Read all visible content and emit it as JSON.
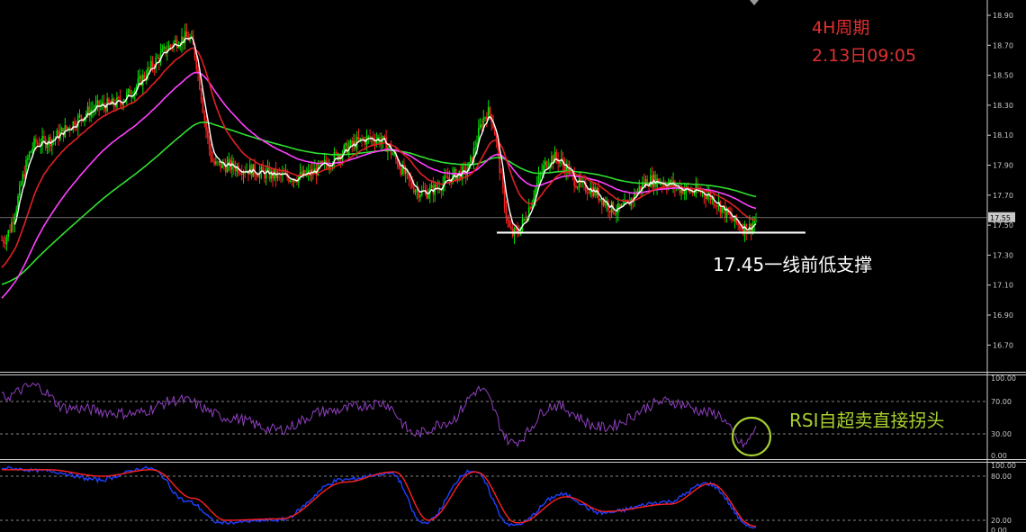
{
  "chart_data": [
    {
      "type": "candlestick",
      "panel": "price",
      "annotations": {
        "timeframe": "4H周期",
        "timestamp": "2.13日09:05",
        "support_label": "17.45一线前低支撑"
      },
      "y_ticks": [
        "18.90",
        "18.70",
        "18.50",
        "18.30",
        "18.10",
        "17.90",
        "17.70",
        "17.50",
        "17.30",
        "17.10",
        "16.90",
        "16.70"
      ],
      "ylim": [
        16.6,
        18.98
      ],
      "current_price": "17.55",
      "support_level": 17.45,
      "colors": {
        "bull": "#00e000",
        "bear": "#ff2020",
        "ma_fast": "#ffffff",
        "ma_mid": "#e02020",
        "ma_slow1": "#ff40ff",
        "ma_slow2": "#30e030",
        "support_line": "#ffffff"
      },
      "key_points": [
        {
          "time": 0,
          "price": 17.4
        },
        {
          "time": 22,
          "price": 18.05
        },
        {
          "time": 65,
          "price": 18.3
        },
        {
          "time": 115,
          "price": 18.75
        },
        {
          "time": 132,
          "price": 17.9
        },
        {
          "time": 180,
          "price": 17.82
        },
        {
          "time": 230,
          "price": 18.08
        },
        {
          "time": 260,
          "price": 17.72
        },
        {
          "time": 285,
          "price": 17.85
        },
        {
          "time": 300,
          "price": 18.25
        },
        {
          "time": 315,
          "price": 17.44
        },
        {
          "time": 340,
          "price": 17.95
        },
        {
          "time": 360,
          "price": 17.75
        },
        {
          "time": 380,
          "price": 17.6
        },
        {
          "time": 400,
          "price": 17.8
        },
        {
          "time": 430,
          "price": 17.72
        },
        {
          "time": 460,
          "price": 17.48
        },
        {
          "time": 465,
          "price": 17.53
        }
      ]
    },
    {
      "type": "line",
      "panel": "rsi",
      "annotation": "RSI自超卖直接拐头",
      "y_ticks": [
        "100.00",
        "70.00",
        "30.00",
        "0.00"
      ],
      "ylim": [
        0,
        100
      ],
      "levels": [
        70,
        30
      ],
      "colors": {
        "line": "#9040c0",
        "circle": "#a8d030"
      },
      "key_points": [
        {
          "time": 0,
          "value": 75
        },
        {
          "time": 20,
          "value": 90
        },
        {
          "time": 40,
          "value": 62
        },
        {
          "time": 80,
          "value": 55
        },
        {
          "time": 110,
          "value": 72
        },
        {
          "time": 140,
          "value": 50
        },
        {
          "time": 170,
          "value": 35
        },
        {
          "time": 200,
          "value": 58
        },
        {
          "time": 235,
          "value": 68
        },
        {
          "time": 255,
          "value": 30
        },
        {
          "time": 275,
          "value": 45
        },
        {
          "time": 295,
          "value": 85
        },
        {
          "time": 315,
          "value": 18
        },
        {
          "time": 340,
          "value": 65
        },
        {
          "time": 370,
          "value": 38
        },
        {
          "time": 410,
          "value": 70
        },
        {
          "time": 440,
          "value": 55
        },
        {
          "time": 458,
          "value": 15
        },
        {
          "time": 465,
          "value": 35
        }
      ]
    },
    {
      "type": "line",
      "panel": "stochastic",
      "y_ticks": [
        "100.00",
        "80.00",
        "20.00",
        "0.00"
      ],
      "ylim": [
        0,
        100
      ],
      "levels": [
        80,
        20
      ],
      "series": [
        {
          "color": "#2040ff",
          "key_points": [
            {
              "time": 0,
              "value": 95
            },
            {
              "time": 25,
              "value": 90
            },
            {
              "time": 60,
              "value": 75
            },
            {
              "time": 90,
              "value": 95
            },
            {
              "time": 115,
              "value": 45
            },
            {
              "time": 135,
              "value": 15
            },
            {
              "time": 170,
              "value": 20
            },
            {
              "time": 210,
              "value": 75
            },
            {
              "time": 240,
              "value": 85
            },
            {
              "time": 260,
              "value": 15
            },
            {
              "time": 290,
              "value": 90
            },
            {
              "time": 315,
              "value": 10
            },
            {
              "time": 345,
              "value": 55
            },
            {
              "time": 370,
              "value": 30
            },
            {
              "time": 410,
              "value": 45
            },
            {
              "time": 435,
              "value": 70
            },
            {
              "time": 465,
              "value": 5
            }
          ]
        },
        {
          "color": "#ff2020",
          "key_points": [
            {
              "time": 0,
              "value": 92
            },
            {
              "time": 28,
              "value": 92
            },
            {
              "time": 62,
              "value": 80
            },
            {
              "time": 92,
              "value": 92
            },
            {
              "time": 118,
              "value": 50
            },
            {
              "time": 138,
              "value": 20
            },
            {
              "time": 172,
              "value": 22
            },
            {
              "time": 212,
              "value": 72
            },
            {
              "time": 242,
              "value": 88
            },
            {
              "time": 263,
              "value": 20
            },
            {
              "time": 292,
              "value": 88
            },
            {
              "time": 318,
              "value": 15
            },
            {
              "time": 348,
              "value": 52
            },
            {
              "time": 372,
              "value": 32
            },
            {
              "time": 412,
              "value": 42
            },
            {
              "time": 437,
              "value": 70
            },
            {
              "time": 465,
              "value": 8
            }
          ]
        }
      ]
    }
  ]
}
